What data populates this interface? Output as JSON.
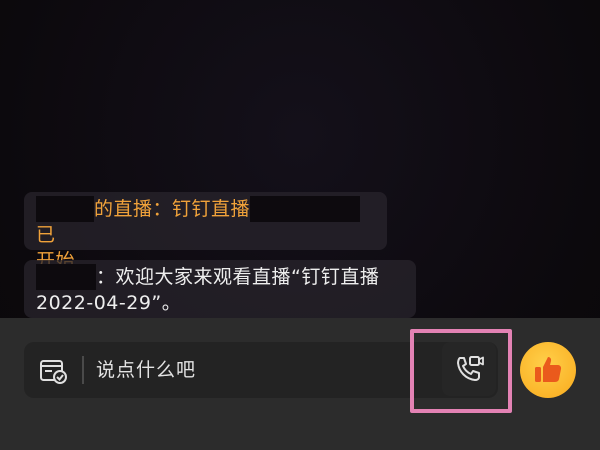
{
  "chat": {
    "messages": [
      {
        "part1": "的直播：钉钉直播",
        "part2": "已",
        "line2": "开始"
      },
      {
        "part1": "：欢迎大家来观看直播“钉钉直播",
        "line2": "2022-04-29”。"
      }
    ]
  },
  "input_bar": {
    "placeholder": "说点什么吧",
    "left_icon": "card-check-icon",
    "call_icon": "phone-video-icon",
    "like_icon": "thumbs-up-icon"
  },
  "colors": {
    "system_message": "#f0a23a",
    "chat_message": "#eeeeee",
    "highlight": "#e382b4",
    "like_button": "#fbb52a"
  }
}
